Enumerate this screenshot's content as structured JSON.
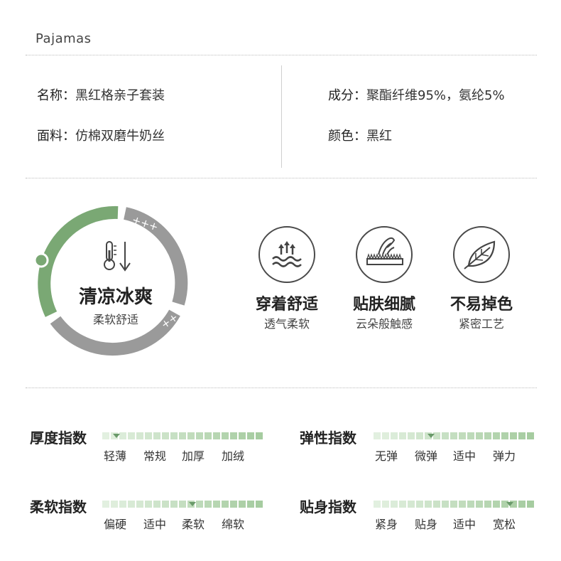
{
  "header": {
    "title": "Pajamas"
  },
  "specs": {
    "name": {
      "label": "名称：",
      "value": "黑红格亲子套装"
    },
    "fabric": {
      "label": "面料：",
      "value": "仿棉双磨牛奶丝"
    },
    "composition": {
      "label": "成分：",
      "value": "聚酯纤维95%，氨纶5%"
    },
    "color": {
      "label": "颜色：",
      "value": "黑红"
    }
  },
  "ring": {
    "title": "清凉冰爽",
    "subtitle": "柔软舒适",
    "top_marks": "+++",
    "bottom_marks": "++",
    "accent": "#7aa874",
    "gray": "#9a9a9a"
  },
  "features": [
    {
      "icon": "wave-breathable-icon",
      "title": "穿着舒适",
      "subtitle": "透气柔软"
    },
    {
      "icon": "hand-fabric-icon",
      "title": "贴肤细腻",
      "subtitle": "云朵般触感"
    },
    {
      "icon": "leaf-icon",
      "title": "不易掉色",
      "subtitle": "紧密工艺"
    }
  ],
  "scales": [
    {
      "title": "厚度指数",
      "labels": [
        "轻薄",
        "常规",
        "加厚",
        "加绒"
      ],
      "level": 0.09
    },
    {
      "title": "弹性指数",
      "labels": [
        "无弹",
        "微弹",
        "适中",
        "弹力"
      ],
      "level": 0.36
    },
    {
      "title": "柔软指数",
      "labels": [
        "偏硬",
        "适中",
        "柔软",
        "绵软"
      ],
      "level": 0.56
    },
    {
      "title": "贴身指数",
      "labels": [
        "紧身",
        "贴身",
        "适中",
        "宽松"
      ],
      "level": 0.85
    }
  ]
}
